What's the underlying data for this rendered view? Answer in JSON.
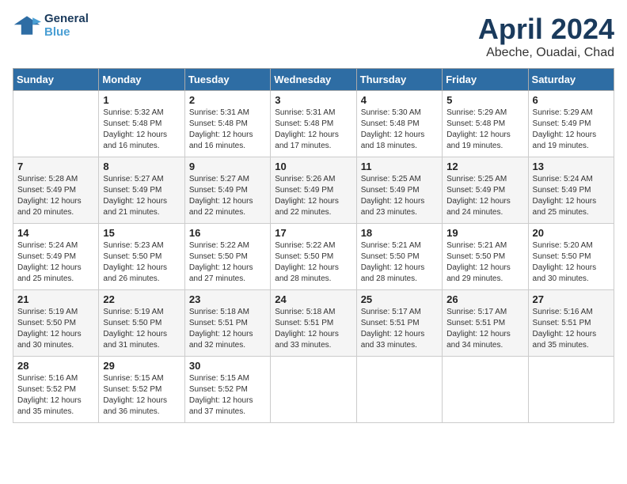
{
  "header": {
    "logo_line1": "General",
    "logo_line2": "Blue",
    "month": "April 2024",
    "location": "Abeche, Ouadai, Chad"
  },
  "columns": [
    "Sunday",
    "Monday",
    "Tuesday",
    "Wednesday",
    "Thursday",
    "Friday",
    "Saturday"
  ],
  "weeks": [
    [
      {
        "day": "",
        "info": ""
      },
      {
        "day": "1",
        "info": "Sunrise: 5:32 AM\nSunset: 5:48 PM\nDaylight: 12 hours\nand 16 minutes."
      },
      {
        "day": "2",
        "info": "Sunrise: 5:31 AM\nSunset: 5:48 PM\nDaylight: 12 hours\nand 16 minutes."
      },
      {
        "day": "3",
        "info": "Sunrise: 5:31 AM\nSunset: 5:48 PM\nDaylight: 12 hours\nand 17 minutes."
      },
      {
        "day": "4",
        "info": "Sunrise: 5:30 AM\nSunset: 5:48 PM\nDaylight: 12 hours\nand 18 minutes."
      },
      {
        "day": "5",
        "info": "Sunrise: 5:29 AM\nSunset: 5:48 PM\nDaylight: 12 hours\nand 19 minutes."
      },
      {
        "day": "6",
        "info": "Sunrise: 5:29 AM\nSunset: 5:49 PM\nDaylight: 12 hours\nand 19 minutes."
      }
    ],
    [
      {
        "day": "7",
        "info": "Sunrise: 5:28 AM\nSunset: 5:49 PM\nDaylight: 12 hours\nand 20 minutes."
      },
      {
        "day": "8",
        "info": "Sunrise: 5:27 AM\nSunset: 5:49 PM\nDaylight: 12 hours\nand 21 minutes."
      },
      {
        "day": "9",
        "info": "Sunrise: 5:27 AM\nSunset: 5:49 PM\nDaylight: 12 hours\nand 22 minutes."
      },
      {
        "day": "10",
        "info": "Sunrise: 5:26 AM\nSunset: 5:49 PM\nDaylight: 12 hours\nand 22 minutes."
      },
      {
        "day": "11",
        "info": "Sunrise: 5:25 AM\nSunset: 5:49 PM\nDaylight: 12 hours\nand 23 minutes."
      },
      {
        "day": "12",
        "info": "Sunrise: 5:25 AM\nSunset: 5:49 PM\nDaylight: 12 hours\nand 24 minutes."
      },
      {
        "day": "13",
        "info": "Sunrise: 5:24 AM\nSunset: 5:49 PM\nDaylight: 12 hours\nand 25 minutes."
      }
    ],
    [
      {
        "day": "14",
        "info": "Sunrise: 5:24 AM\nSunset: 5:49 PM\nDaylight: 12 hours\nand 25 minutes."
      },
      {
        "day": "15",
        "info": "Sunrise: 5:23 AM\nSunset: 5:50 PM\nDaylight: 12 hours\nand 26 minutes."
      },
      {
        "day": "16",
        "info": "Sunrise: 5:22 AM\nSunset: 5:50 PM\nDaylight: 12 hours\nand 27 minutes."
      },
      {
        "day": "17",
        "info": "Sunrise: 5:22 AM\nSunset: 5:50 PM\nDaylight: 12 hours\nand 28 minutes."
      },
      {
        "day": "18",
        "info": "Sunrise: 5:21 AM\nSunset: 5:50 PM\nDaylight: 12 hours\nand 28 minutes."
      },
      {
        "day": "19",
        "info": "Sunrise: 5:21 AM\nSunset: 5:50 PM\nDaylight: 12 hours\nand 29 minutes."
      },
      {
        "day": "20",
        "info": "Sunrise: 5:20 AM\nSunset: 5:50 PM\nDaylight: 12 hours\nand 30 minutes."
      }
    ],
    [
      {
        "day": "21",
        "info": "Sunrise: 5:19 AM\nSunset: 5:50 PM\nDaylight: 12 hours\nand 30 minutes."
      },
      {
        "day": "22",
        "info": "Sunrise: 5:19 AM\nSunset: 5:50 PM\nDaylight: 12 hours\nand 31 minutes."
      },
      {
        "day": "23",
        "info": "Sunrise: 5:18 AM\nSunset: 5:51 PM\nDaylight: 12 hours\nand 32 minutes."
      },
      {
        "day": "24",
        "info": "Sunrise: 5:18 AM\nSunset: 5:51 PM\nDaylight: 12 hours\nand 33 minutes."
      },
      {
        "day": "25",
        "info": "Sunrise: 5:17 AM\nSunset: 5:51 PM\nDaylight: 12 hours\nand 33 minutes."
      },
      {
        "day": "26",
        "info": "Sunrise: 5:17 AM\nSunset: 5:51 PM\nDaylight: 12 hours\nand 34 minutes."
      },
      {
        "day": "27",
        "info": "Sunrise: 5:16 AM\nSunset: 5:51 PM\nDaylight: 12 hours\nand 35 minutes."
      }
    ],
    [
      {
        "day": "28",
        "info": "Sunrise: 5:16 AM\nSunset: 5:52 PM\nDaylight: 12 hours\nand 35 minutes."
      },
      {
        "day": "29",
        "info": "Sunrise: 5:15 AM\nSunset: 5:52 PM\nDaylight: 12 hours\nand 36 minutes."
      },
      {
        "day": "30",
        "info": "Sunrise: 5:15 AM\nSunset: 5:52 PM\nDaylight: 12 hours\nand 37 minutes."
      },
      {
        "day": "",
        "info": ""
      },
      {
        "day": "",
        "info": ""
      },
      {
        "day": "",
        "info": ""
      },
      {
        "day": "",
        "info": ""
      }
    ]
  ]
}
